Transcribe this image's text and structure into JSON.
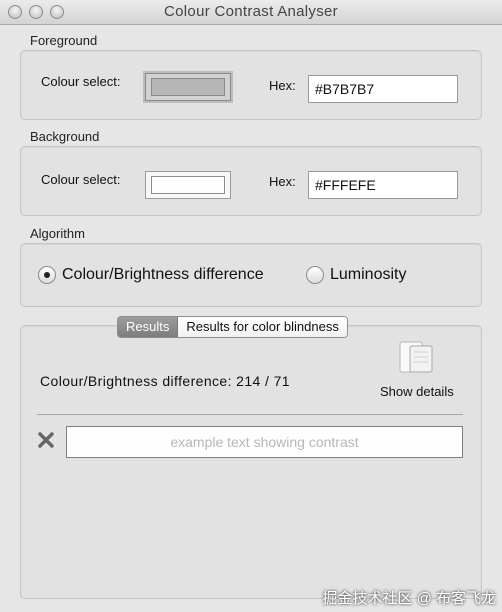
{
  "window": {
    "title": "Colour Contrast Analyser"
  },
  "foreground": {
    "section_label": "Foreground",
    "colour_select_label": "Colour select:",
    "hex_label": "Hex:",
    "hex_value": "#B7B7B7",
    "swatch_color": "#B7B7B7"
  },
  "background": {
    "section_label": "Background",
    "colour_select_label": "Colour select:",
    "hex_label": "Hex:",
    "hex_value": "#FFFEFE",
    "swatch_color": "#FFFEFE"
  },
  "algorithm": {
    "section_label": "Algorithm",
    "options": [
      {
        "label": "Colour/Brightness difference",
        "selected": true
      },
      {
        "label": "Luminosity",
        "selected": false
      }
    ]
  },
  "results": {
    "tabs": [
      {
        "label": "Results",
        "selected": true
      },
      {
        "label": "Results for color blindness",
        "selected": false
      }
    ],
    "result_text": "Colour/Brightness difference: 214 / 71",
    "show_details_label": "Show details",
    "sample_text": "example text showing contrast",
    "status_icon": "x-mark-icon"
  },
  "watermark": "掘金技术社区 @ 布客飞龙"
}
